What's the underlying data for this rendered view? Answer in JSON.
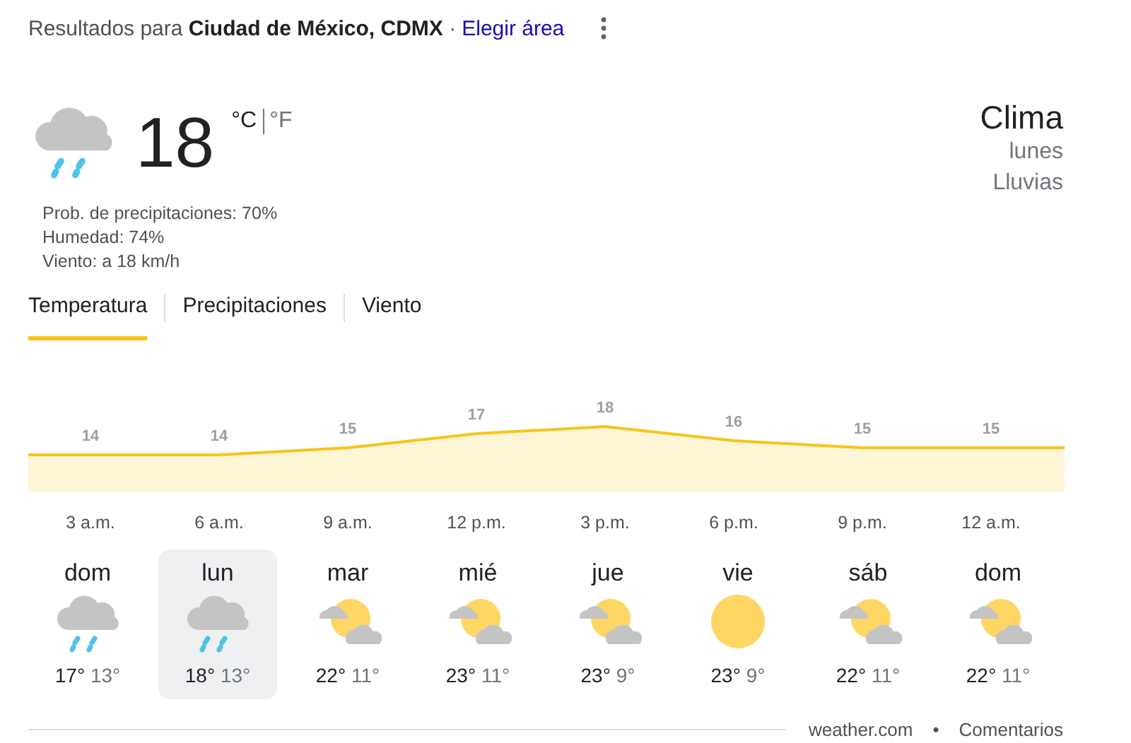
{
  "header": {
    "results_text": "Resultados para **Ciudad de México, CDMX** ·",
    "link": "Elegir área"
  },
  "current": {
    "kind": "rain",
    "temperature": "18",
    "units": [
      {
        "label": "°C",
        "selected": true
      },
      {
        "label": "°F",
        "selected": false
      }
    ],
    "details": [
      "Prob. de precipitaciones: 70%",
      "Humedad: 74%",
      "Viento: a 18 km/h"
    ],
    "title": "Clima",
    "day": "lunes",
    "condition": "Lluvias"
  },
  "tabs": [
    {
      "label": "Temperatura",
      "selected": true
    },
    {
      "label": "Precipitaciones",
      "selected": false
    },
    {
      "label": "Viento",
      "selected": false
    }
  ],
  "chart_data": {
    "type": "area",
    "categories": [
      "3 a.m.",
      "6 a.m.",
      "9 a.m.",
      "12 p.m.",
      "3 p.m.",
      "6 p.m.",
      "9 p.m.",
      "12 a.m."
    ],
    "series": [
      {
        "color": "#f5c518",
        "values": [
          14,
          14,
          15,
          17,
          18,
          16,
          15,
          15
        ]
      }
    ],
    "data_labels": true
  },
  "days": [
    {
      "name": "dom",
      "kind": "rain",
      "high": "17°",
      "low": "13°",
      "selected": false
    },
    {
      "name": "lun",
      "kind": "rain",
      "high": "18°",
      "low": "13°",
      "selected": true
    },
    {
      "name": "mar",
      "kind": "partly_cloudy",
      "high": "22°",
      "low": "11°",
      "selected": false
    },
    {
      "name": "mié",
      "kind": "partly_cloudy",
      "high": "23°",
      "low": "11°",
      "selected": false
    },
    {
      "name": "jue",
      "kind": "partly_cloudy",
      "high": "23°",
      "low": "9°",
      "selected": false
    },
    {
      "name": "vie",
      "kind": "sunny",
      "high": "23°",
      "low": "9°",
      "selected": false
    },
    {
      "name": "sáb",
      "kind": "partly_cloudy",
      "high": "22°",
      "low": "11°",
      "selected": false
    },
    {
      "name": "dom",
      "kind": "partly_cloudy",
      "high": "22°",
      "low": "11°",
      "selected": false
    }
  ],
  "footer": {
    "source": "weather.com",
    "separator": "•",
    "feedback": "Comentarios"
  }
}
